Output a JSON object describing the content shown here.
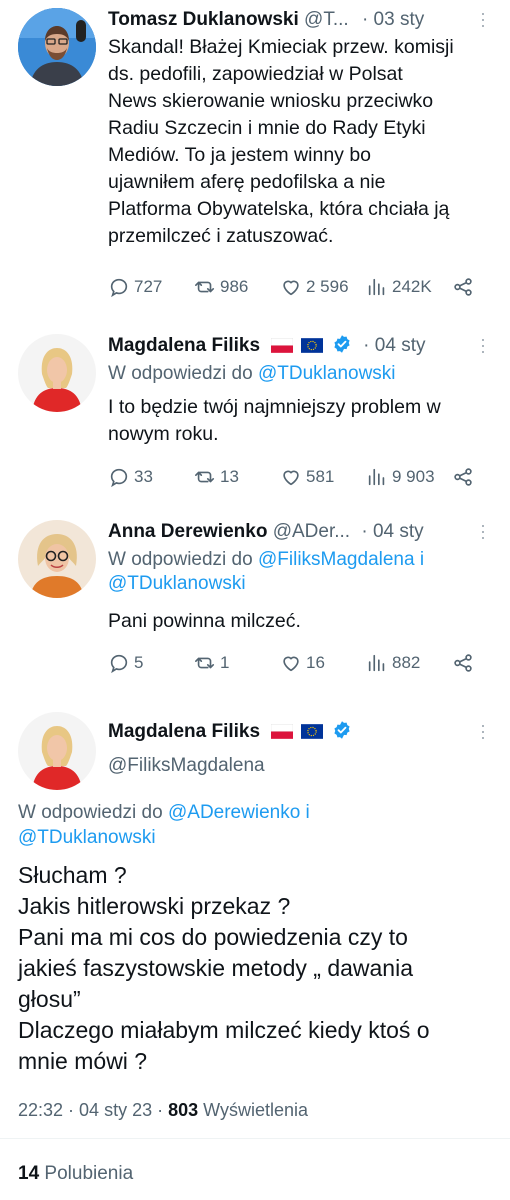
{
  "tweets": [
    {
      "name": "Tomasz Duklanowski",
      "handle": "@T...",
      "date": "· 03 sty",
      "body": "Skandal! Błażej Kmieciak przew. komisji\nds. pedofili, zapowiedział w Polsat\nNews skierowanie wniosku przeciwko\nRadiu Szczecin i mnie do Rady Etyki\nMediów. To ja jestem winny bo\nujawniłem aferę pedofilska a nie\nPlatforma Obywatelska, która chciała ją\nprzemilczeć i zatuszować.",
      "replies": "727",
      "retweets": "986",
      "likes": "2 596",
      "views": "242K"
    },
    {
      "name": "Magdalena Filiks",
      "date": "· 04 sty",
      "reply_prefix": "W odpowiedzi do",
      "reply_to": "@TDuklanowski",
      "body": "I to będzie twój najmniejszy problem w\nnowym roku.",
      "replies": "33",
      "retweets": "13",
      "likes": "581",
      "views": "9 903"
    },
    {
      "name": "Anna Derewienko",
      "handle": "@ADer...",
      "date": "· 04 sty",
      "reply_prefix": "W odpowiedzi do",
      "reply_to_1": "@FiliksMagdalena i",
      "reply_to_2": "@TDuklanowski",
      "body": "Pani powinna milczeć.",
      "replies": "5",
      "retweets": "1",
      "likes": "16",
      "views": "882"
    }
  ],
  "focus": {
    "name": "Magdalena Filiks",
    "handle": "@FiliksMagdalena",
    "reply_prefix": "W odpowiedzi do",
    "reply_to_1": "@ADerewienko i",
    "reply_to_2": "@TDuklanowski",
    "body": "Słucham ?\nJakis hitlerowski  przekaz ?\nPani ma mi cos do powiedzenia czy to\njakieś faszystowskie metody „ dawania\ngłosu”\nDlaczego miałabym milczeć kiedy ktoś o\nmnie mówi ?",
    "time": "22:32 · 04 sty 23 ·",
    "views_count": "803",
    "views_label": "Wyświetlenia",
    "likes_count": "14",
    "likes_label": "Polubienia"
  },
  "colors": {
    "accent": "#1d9bf0",
    "muted": "#536471",
    "verified": "#1d9bf0"
  }
}
